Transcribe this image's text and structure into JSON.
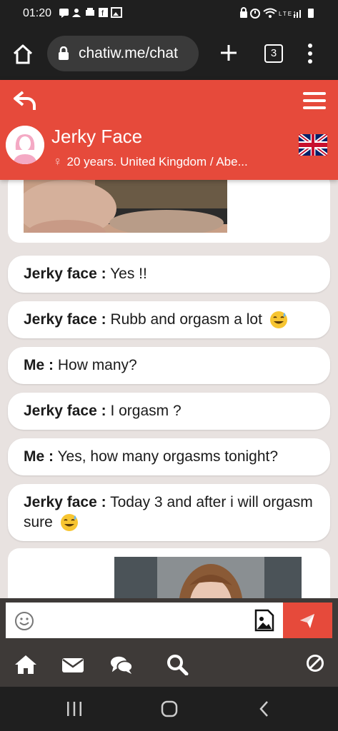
{
  "status_bar": {
    "time": "01:20",
    "left_icons": [
      "chat-bubble-icon",
      "shield-person-icon",
      "printer-icon",
      "facebook-icon",
      "gallery-icon"
    ],
    "right_icons": [
      "lock-icon",
      "alarm-icon",
      "wifi-icon",
      "signal-icon",
      "battery-icon"
    ],
    "network": "LTE1"
  },
  "browser": {
    "url": "chatiw.me/chat",
    "tab_count": "3"
  },
  "header": {
    "name": "Jerky Face",
    "subtitle": "20 years. United Kingdom / Abe...",
    "gender_symbol": "♀",
    "accent": "#e64a3b"
  },
  "messages": [
    {
      "sender": "Jerky face :",
      "text": "Yes !!"
    },
    {
      "sender": "Jerky face :",
      "text": "Rubb and orgasm a lot",
      "emoji": "sweat-smile"
    },
    {
      "sender": "Me :",
      "text": "How many?"
    },
    {
      "sender": "Jerky face :",
      "text": "I orgasm ?"
    },
    {
      "sender": "Me :",
      "text": "Yes, how many orgasms tonight?"
    },
    {
      "sender": "Jerky face :",
      "text": "Today 3 and after i will orgasm sure",
      "emoji": "sweat-smile"
    }
  ],
  "composer": {
    "placeholder": "",
    "value": ""
  },
  "bottom_nav": [
    "home-icon",
    "mail-icon",
    "chats-icon",
    "search-icon",
    "block-icon"
  ]
}
